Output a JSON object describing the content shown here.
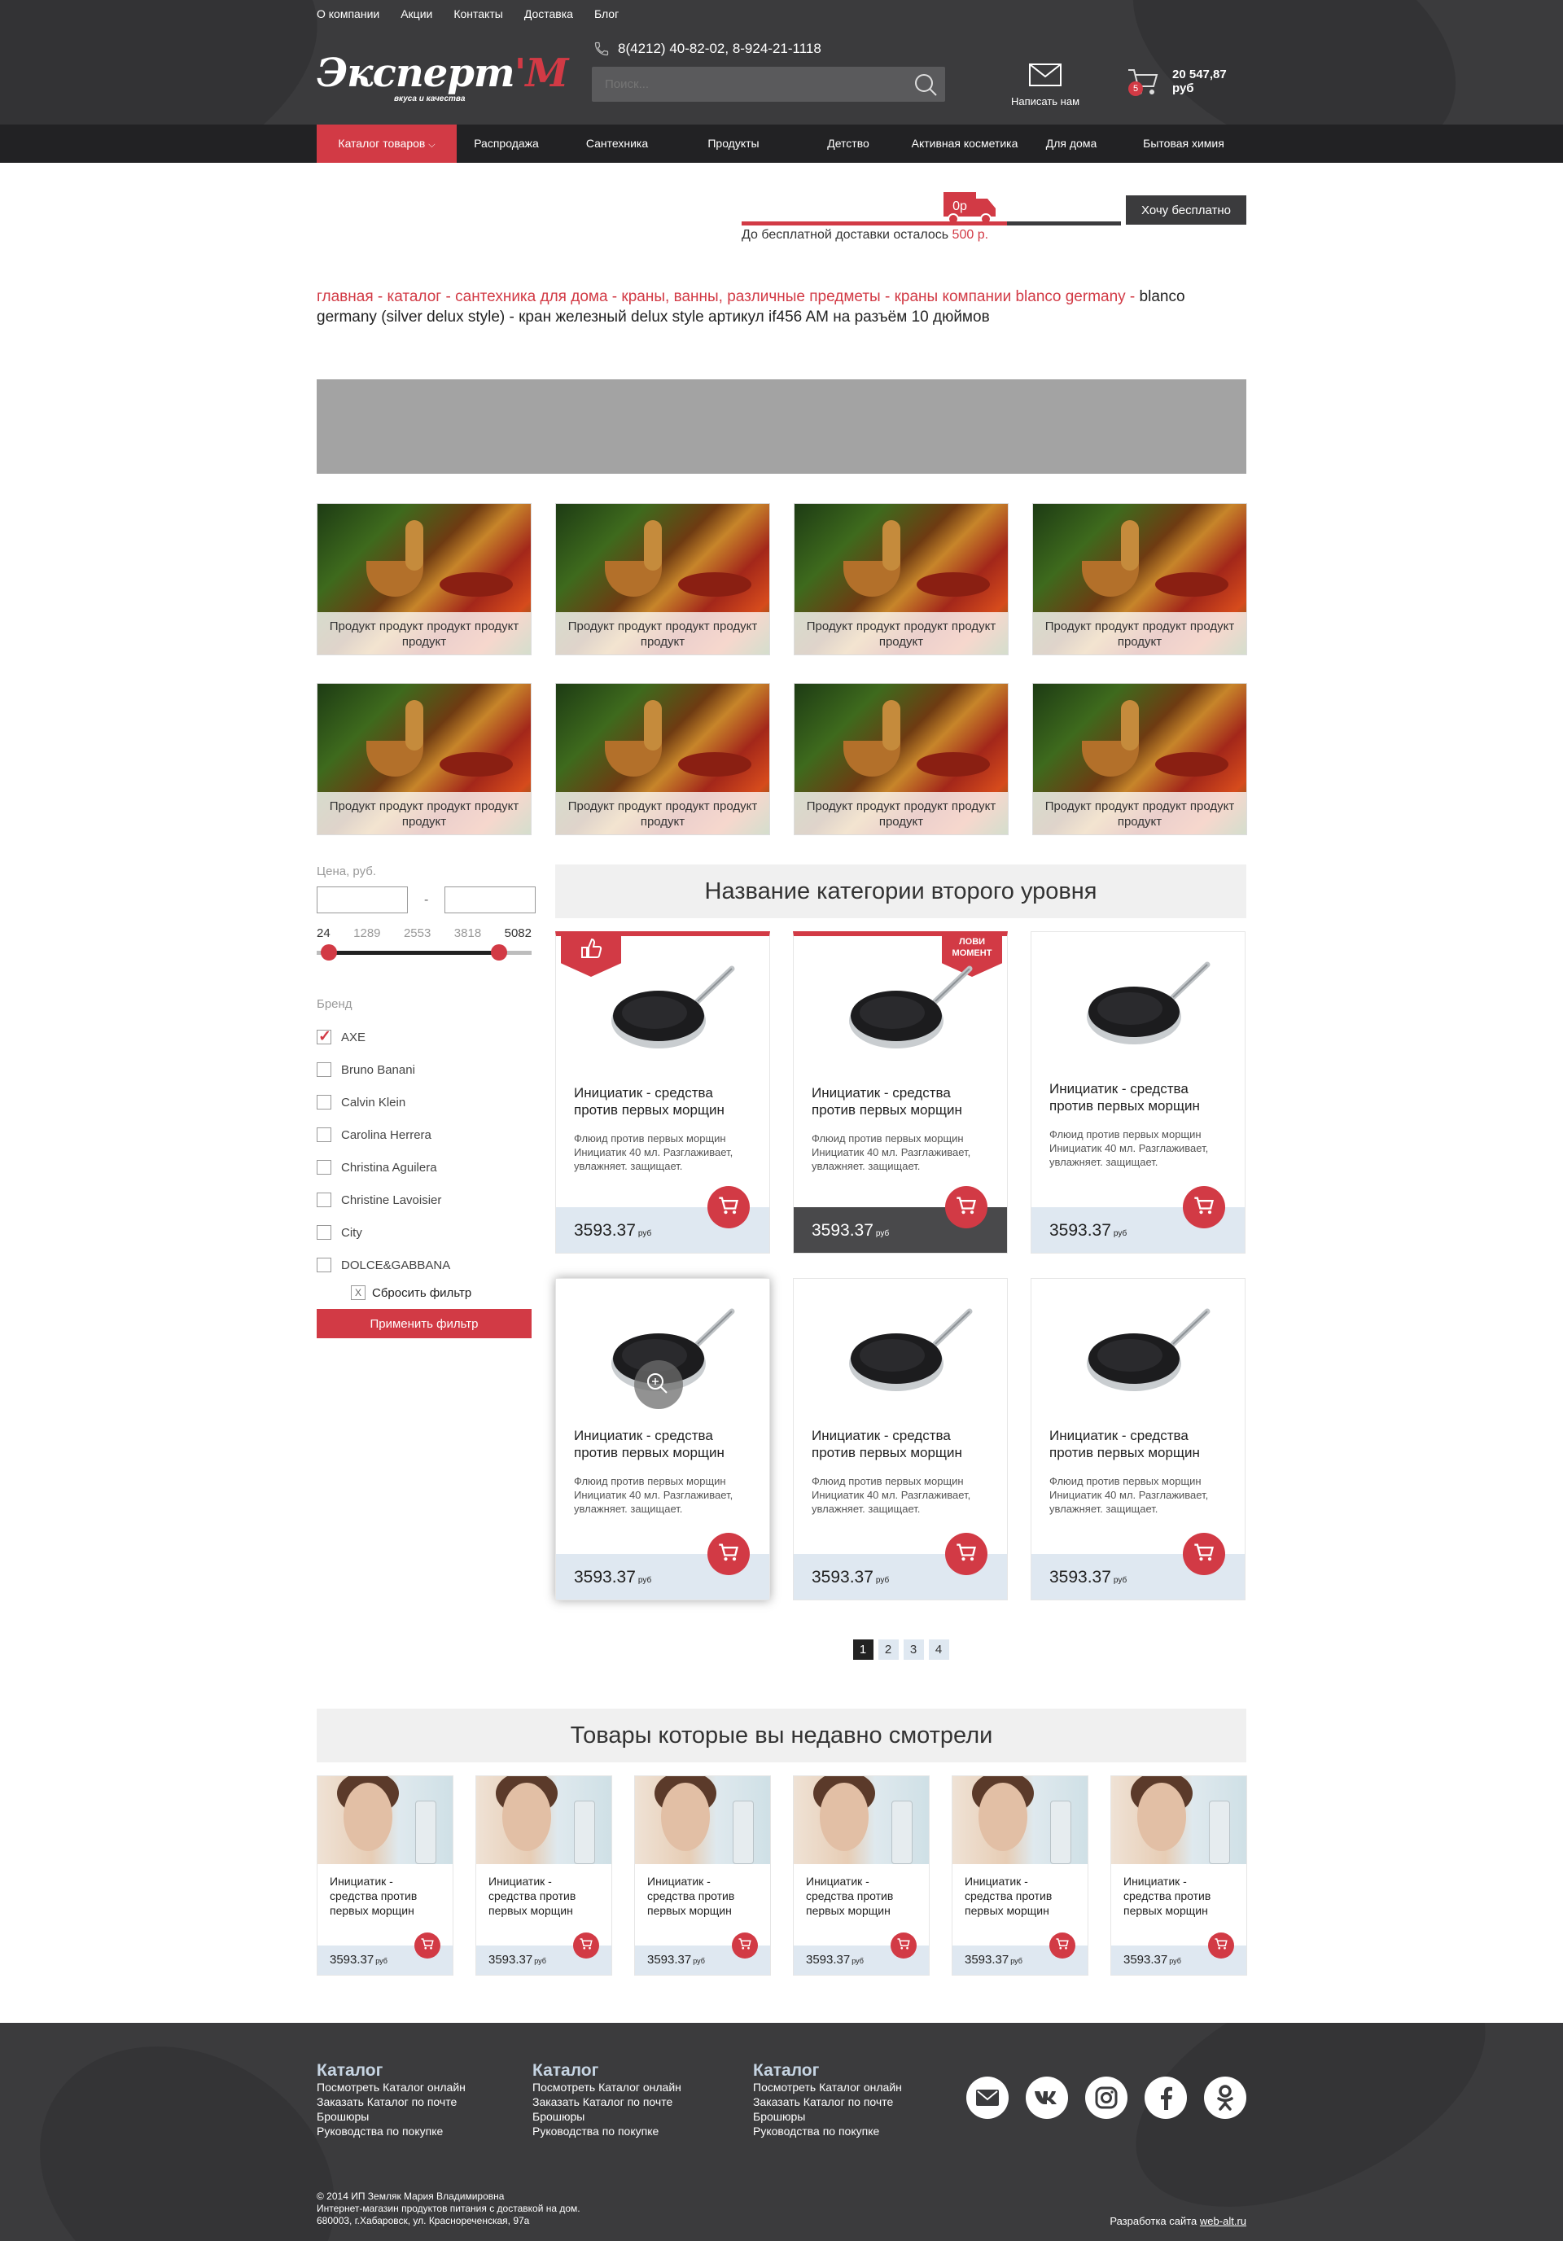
{
  "header": {
    "top_nav": [
      "О компании",
      "Акции",
      "Контакты",
      "Доставка",
      "Блог"
    ],
    "logo_text": "Эксперт",
    "logo_m": "'M",
    "logo_tagline": "вкуса и качества",
    "phone": "8(4212) 40-82-02, 8-924-21-1118",
    "search_placeholder": "Поиск...",
    "mail_label": "Написать нам",
    "cart_count": "5",
    "cart_sum": "20 547,87 руб"
  },
  "main_nav": {
    "active": "Каталог товаров",
    "items": [
      "Распродажа",
      "Сантехника",
      "Продукты",
      "Детство",
      "Активная косметика",
      "Для дома",
      "Бытовая химия"
    ]
  },
  "delivery": {
    "truck_label": "0р",
    "text": "До бесплатной доставки осталось",
    "amount": "500 р.",
    "button": "Хочу бесплатно",
    "progress": 0.7
  },
  "breadcrumb": {
    "links": [
      "главная",
      "каталог",
      "сантехника для дома",
      "краны, ванны, различные предметы",
      "краны компании blanco germany"
    ],
    "current": "blanco germany (silver delux style) - кран железный delux style артикул if456 AM на разъём 10 дюймов"
  },
  "promo": {
    "caption": "Продукт продукт продукт продукт продукт"
  },
  "filters": {
    "price_label": "Цена, руб.",
    "price_dash": "-",
    "ticks": [
      "24",
      "1289",
      "2553",
      "3818",
      "5082"
    ],
    "range": [
      0.05,
      0.85
    ],
    "brand_label": "Бренд",
    "brands": [
      {
        "name": "AXE",
        "checked": true
      },
      {
        "name": "Bruno Banani",
        "checked": false
      },
      {
        "name": "Calvin Klein",
        "checked": false
      },
      {
        "name": "Carolina Herrera",
        "checked": false
      },
      {
        "name": "Christina Aguilera",
        "checked": false
      },
      {
        "name": "Christine Lavoisier",
        "checked": false
      },
      {
        "name": "City",
        "checked": false
      },
      {
        "name": "DOLCE&GABBANA",
        "checked": false
      }
    ],
    "reset_x": "X",
    "reset": "Сбросить фильтр",
    "apply": "Применить фильтр"
  },
  "catalog": {
    "category_title": "Название категории второго уровня",
    "product_name": "Инициатик - средства против первых морщин",
    "product_desc": "Флюид против первых морщин Инициатик 40 мл. Разглаживает, увлажняет. защищает.",
    "price": "3593.37",
    "currency": "руб",
    "sale_badge": "ЛОВИ МОМЕНТ",
    "pages": [
      "1",
      "2",
      "3",
      "4"
    ],
    "current_page": "1"
  },
  "recent": {
    "title": "Товары которые вы недавно смотрели",
    "name": "Инициатик - средства против первых морщин",
    "price": "3593.37",
    "currency": "руб"
  },
  "footer": {
    "columns": [
      {
        "title": "Каталог",
        "links": [
          "Посмотреть Каталог онлайн",
          "Заказать Каталог по почте",
          "Брошюры",
          "Руководства по покупке"
        ]
      },
      {
        "title": "Каталог",
        "links": [
          "Посмотреть Каталог онлайн",
          "Заказать Каталог по почте",
          "Брошюры",
          "Руководства по покупке"
        ]
      },
      {
        "title": "Каталог",
        "links": [
          "Посмотреть Каталог онлайн",
          "Заказать Каталог по почте",
          "Брошюры",
          "Руководства по покупке"
        ]
      }
    ],
    "social": [
      "mail-icon",
      "vk-icon",
      "instagram-icon",
      "facebook-icon",
      "odnoklassniki-icon"
    ],
    "copyright": [
      "© 2014 ИП Земляк Мария Владимировна",
      "Интернет-магазин продуктов питания с доставкой на дом.",
      "680003, г.Хабаровск, ул. Краснореченская, 97а"
    ],
    "dev_label": "Разработка сайта",
    "dev_link": "web-alt.ru"
  },
  "colors": {
    "accent": "#d23a45",
    "dark": "#3b3b3d",
    "darker": "#222224",
    "price_bg": "#dfe8f1"
  }
}
